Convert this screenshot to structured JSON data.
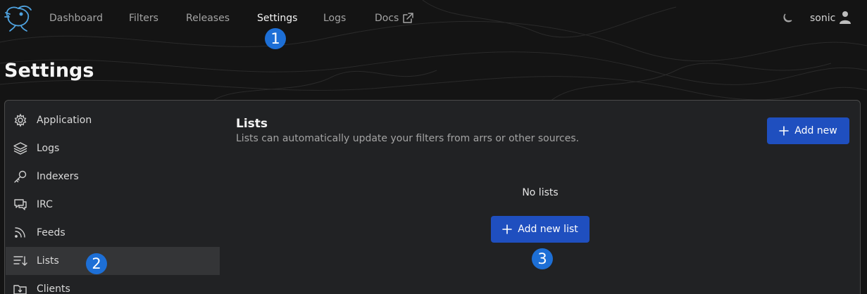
{
  "nav": {
    "items": [
      {
        "label": "Dashboard",
        "active": false
      },
      {
        "label": "Filters",
        "active": false
      },
      {
        "label": "Releases",
        "active": false
      },
      {
        "label": "Settings",
        "active": true
      },
      {
        "label": "Logs",
        "active": false
      },
      {
        "label": "Docs",
        "active": false
      }
    ],
    "user": "sonic"
  },
  "page": {
    "title": "Settings"
  },
  "sidebar": {
    "items": [
      {
        "label": "Application",
        "icon": "cog-icon"
      },
      {
        "label": "Logs",
        "icon": "layers-icon"
      },
      {
        "label": "Indexers",
        "icon": "key-icon"
      },
      {
        "label": "IRC",
        "icon": "chat-bubbles-icon"
      },
      {
        "label": "Feeds",
        "icon": "rss-icon"
      },
      {
        "label": "Lists",
        "icon": "list-sort-icon",
        "active": true
      },
      {
        "label": "Clients",
        "icon": "folder-download-icon"
      }
    ]
  },
  "section": {
    "title": "Lists",
    "description": "Lists can automatically update your filters from arrs or other sources.",
    "add_new_label": "Add new",
    "empty_text": "No lists",
    "add_list_label": "Add new list"
  },
  "badges": [
    "1",
    "2",
    "3"
  ],
  "colors": {
    "background": "#141414",
    "panel": "#212224",
    "accent_button": "#1f4fbf",
    "badge": "#1d6fd6",
    "active_sidebar": "#343537"
  }
}
